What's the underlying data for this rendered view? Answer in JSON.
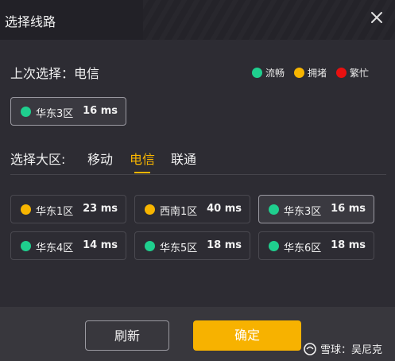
{
  "dialog": {
    "title": "选择线路"
  },
  "last_selection": {
    "label": "上次选择：电信",
    "server": {
      "name": "华东3区",
      "ms": "16 ms",
      "status_color": "#1fcf8e"
    }
  },
  "legend": [
    {
      "label": "流畅",
      "color": "#1fcf8e"
    },
    {
      "label": "拥堵",
      "color": "#f7b500"
    },
    {
      "label": "繁忙",
      "color": "#e81010"
    }
  ],
  "region": {
    "label": "选择大区:",
    "tabs": [
      {
        "label": "移动",
        "active": false
      },
      {
        "label": "电信",
        "active": true
      },
      {
        "label": "联通",
        "active": false
      }
    ]
  },
  "servers": [
    {
      "name": "华东1区",
      "ms": "23 ms",
      "status_color": "#f7b500",
      "selected": false
    },
    {
      "name": "西南1区",
      "ms": "40 ms",
      "status_color": "#f7b500",
      "selected": false
    },
    {
      "name": "华东3区",
      "ms": "16 ms",
      "status_color": "#1fcf8e",
      "selected": true
    },
    {
      "name": "华东4区",
      "ms": "14 ms",
      "status_color": "#1fcf8e",
      "selected": false
    },
    {
      "name": "华东5区",
      "ms": "18 ms",
      "status_color": "#1fcf8e",
      "selected": false
    },
    {
      "name": "华东6区",
      "ms": "18 ms",
      "status_color": "#1fcf8e",
      "selected": false
    }
  ],
  "footer": {
    "refresh_label": "刷新",
    "ok_label": "确定",
    "watermark": "雪球：吴尼克"
  }
}
